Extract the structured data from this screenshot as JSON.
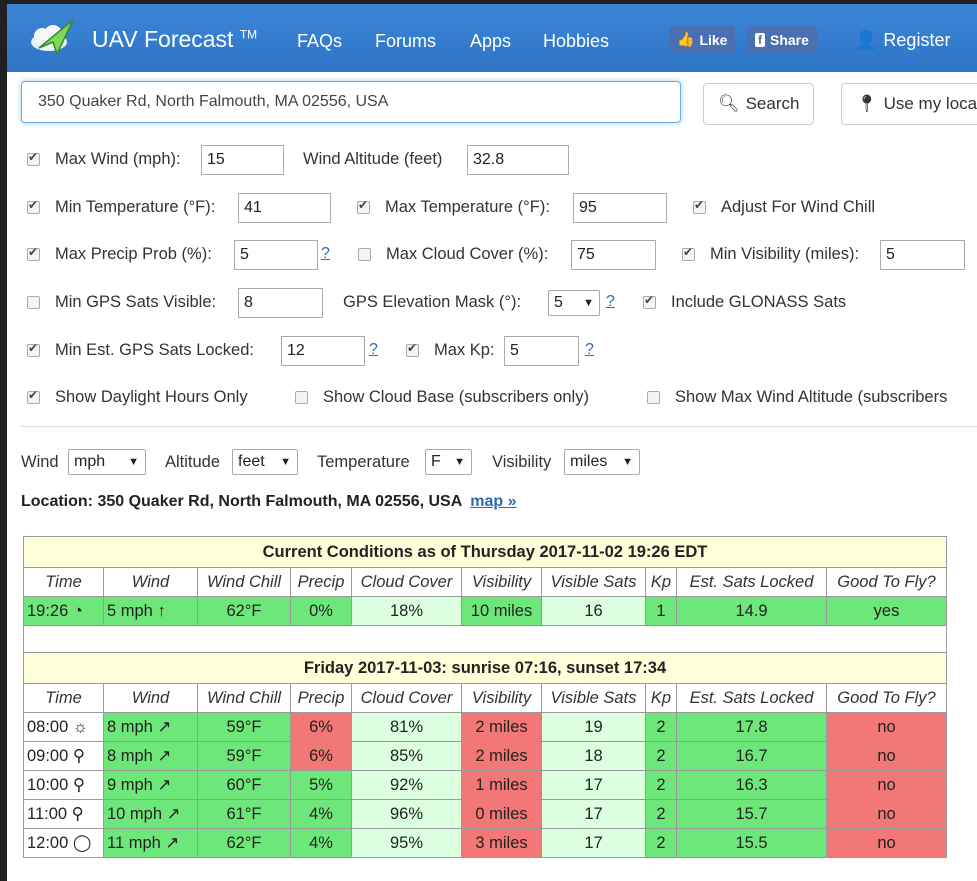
{
  "nav": {
    "brand": "UAV Forecast",
    "tm": "TM",
    "links": [
      "FAQs",
      "Forums",
      "Apps",
      "Hobbies"
    ],
    "like": "Like",
    "share": "Share",
    "register": "Register"
  },
  "search": {
    "address": "350 Quaker Rd, North Falmouth, MA 02556, USA",
    "search_label": "Search",
    "location_label": "Use my loca"
  },
  "options": {
    "max_wind": {
      "label": "Max Wind (mph):",
      "value": "15",
      "checked": true
    },
    "wind_altitude": {
      "label": "Wind Altitude (feet)",
      "value": "32.8"
    },
    "min_temp": {
      "label": "Min Temperature (°F):",
      "value": "41",
      "checked": true
    },
    "max_temp": {
      "label": "Max Temperature (°F):",
      "value": "95",
      "checked": true
    },
    "wind_chill": {
      "label": "Adjust For Wind Chill",
      "checked": true
    },
    "max_precip": {
      "label": "Max Precip Prob (%):",
      "value": "5",
      "checked": true
    },
    "max_cloud": {
      "label": "Max Cloud Cover (%):",
      "value": "75",
      "checked": false
    },
    "min_vis": {
      "label": "Min Visibility (miles):",
      "value": "5",
      "checked": true
    },
    "min_gps": {
      "label": "Min GPS Sats Visible:",
      "value": "8",
      "checked": false
    },
    "gps_mask": {
      "label": "GPS Elevation Mask (°):",
      "value": "5"
    },
    "glonass": {
      "label": "Include GLONASS Sats",
      "checked": true
    },
    "min_locked": {
      "label": "Min Est. GPS Sats Locked:",
      "value": "12",
      "checked": true
    },
    "max_kp": {
      "label": "Max Kp:",
      "value": "5",
      "checked": true
    },
    "daylight": {
      "label": "Show Daylight Hours Only",
      "checked": true
    },
    "cloud_base": {
      "label": "Show Cloud Base (subscribers only)",
      "checked": false
    },
    "max_wind_alt": {
      "label": "Show Max Wind Altitude (subscribers",
      "checked": false
    },
    "help": "?"
  },
  "units": {
    "wind": {
      "label": "Wind",
      "value": "mph"
    },
    "altitude": {
      "label": "Altitude",
      "value": "feet"
    },
    "temperature": {
      "label": "Temperature",
      "value": "F"
    },
    "visibility": {
      "label": "Visibility",
      "value": "miles"
    }
  },
  "location": {
    "text": "Location: 350 Quaker Rd, North Falmouth, MA 02556, USA",
    "map": "map »"
  },
  "table": {
    "headers": [
      "Time",
      "Wind",
      "Wind Chill",
      "Precip",
      "Cloud Cover",
      "Visibility",
      "Visible Sats",
      "Kp",
      "Est. Sats Locked",
      "Good To Fly?"
    ],
    "current_title": "Current Conditions as of Thursday 2017-11-02 19:26 EDT",
    "current": [
      {
        "time": "19:26",
        "icon": "◔",
        "wind": "5 mph",
        "arrow": "↑",
        "chill": "62°F",
        "precip": "0%",
        "cloud": "18%",
        "vis": "10 miles",
        "sats": "16",
        "kp": "1",
        "locked": "14.9",
        "fly": "yes",
        "c": [
          "g",
          "g",
          "g",
          "g",
          "lg",
          "g",
          "lg",
          "g",
          "g",
          "g"
        ]
      }
    ],
    "day_title": "Friday 2017-11-03: sunrise 07:16, sunset 17:34",
    "rows": [
      {
        "time": "08:00",
        "icon": "☼",
        "wind": "8 mph",
        "arrow": "↗",
        "chill": "59°F",
        "precip": "6%",
        "cloud": "81%",
        "vis": "2 miles",
        "sats": "19",
        "kp": "2",
        "locked": "17.8",
        "fly": "no",
        "c": [
          "w",
          "g",
          "g",
          "r",
          "lg",
          "r",
          "lg",
          "g",
          "g",
          "r"
        ]
      },
      {
        "time": "09:00",
        "icon": "⚲",
        "wind": "8 mph",
        "arrow": "↗",
        "chill": "59°F",
        "precip": "6%",
        "cloud": "85%",
        "vis": "2 miles",
        "sats": "18",
        "kp": "2",
        "locked": "16.7",
        "fly": "no",
        "c": [
          "w",
          "g",
          "g",
          "r",
          "lg",
          "r",
          "lg",
          "g",
          "g",
          "r"
        ]
      },
      {
        "time": "10:00",
        "icon": "⚲",
        "wind": "9 mph",
        "arrow": "↗",
        "chill": "60°F",
        "precip": "5%",
        "cloud": "92%",
        "vis": "1 miles",
        "sats": "17",
        "kp": "2",
        "locked": "16.3",
        "fly": "no",
        "c": [
          "w",
          "g",
          "g",
          "g",
          "lg",
          "r",
          "lg",
          "g",
          "g",
          "r"
        ]
      },
      {
        "time": "11:00",
        "icon": "⚲",
        "wind": "10 mph",
        "arrow": "↗",
        "chill": "61°F",
        "precip": "4%",
        "cloud": "96%",
        "vis": "0 miles",
        "sats": "17",
        "kp": "2",
        "locked": "15.7",
        "fly": "no",
        "c": [
          "w",
          "g",
          "g",
          "g",
          "lg",
          "r",
          "lg",
          "g",
          "g",
          "r"
        ]
      },
      {
        "time": "12:00",
        "icon": "◯",
        "wind": "11 mph",
        "arrow": "↗",
        "chill": "62°F",
        "precip": "4%",
        "cloud": "95%",
        "vis": "3 miles",
        "sats": "17",
        "kp": "2",
        "locked": "15.5",
        "fly": "no",
        "c": [
          "w",
          "g",
          "g",
          "g",
          "lg",
          "r",
          "lg",
          "g",
          "g",
          "r"
        ]
      }
    ]
  }
}
